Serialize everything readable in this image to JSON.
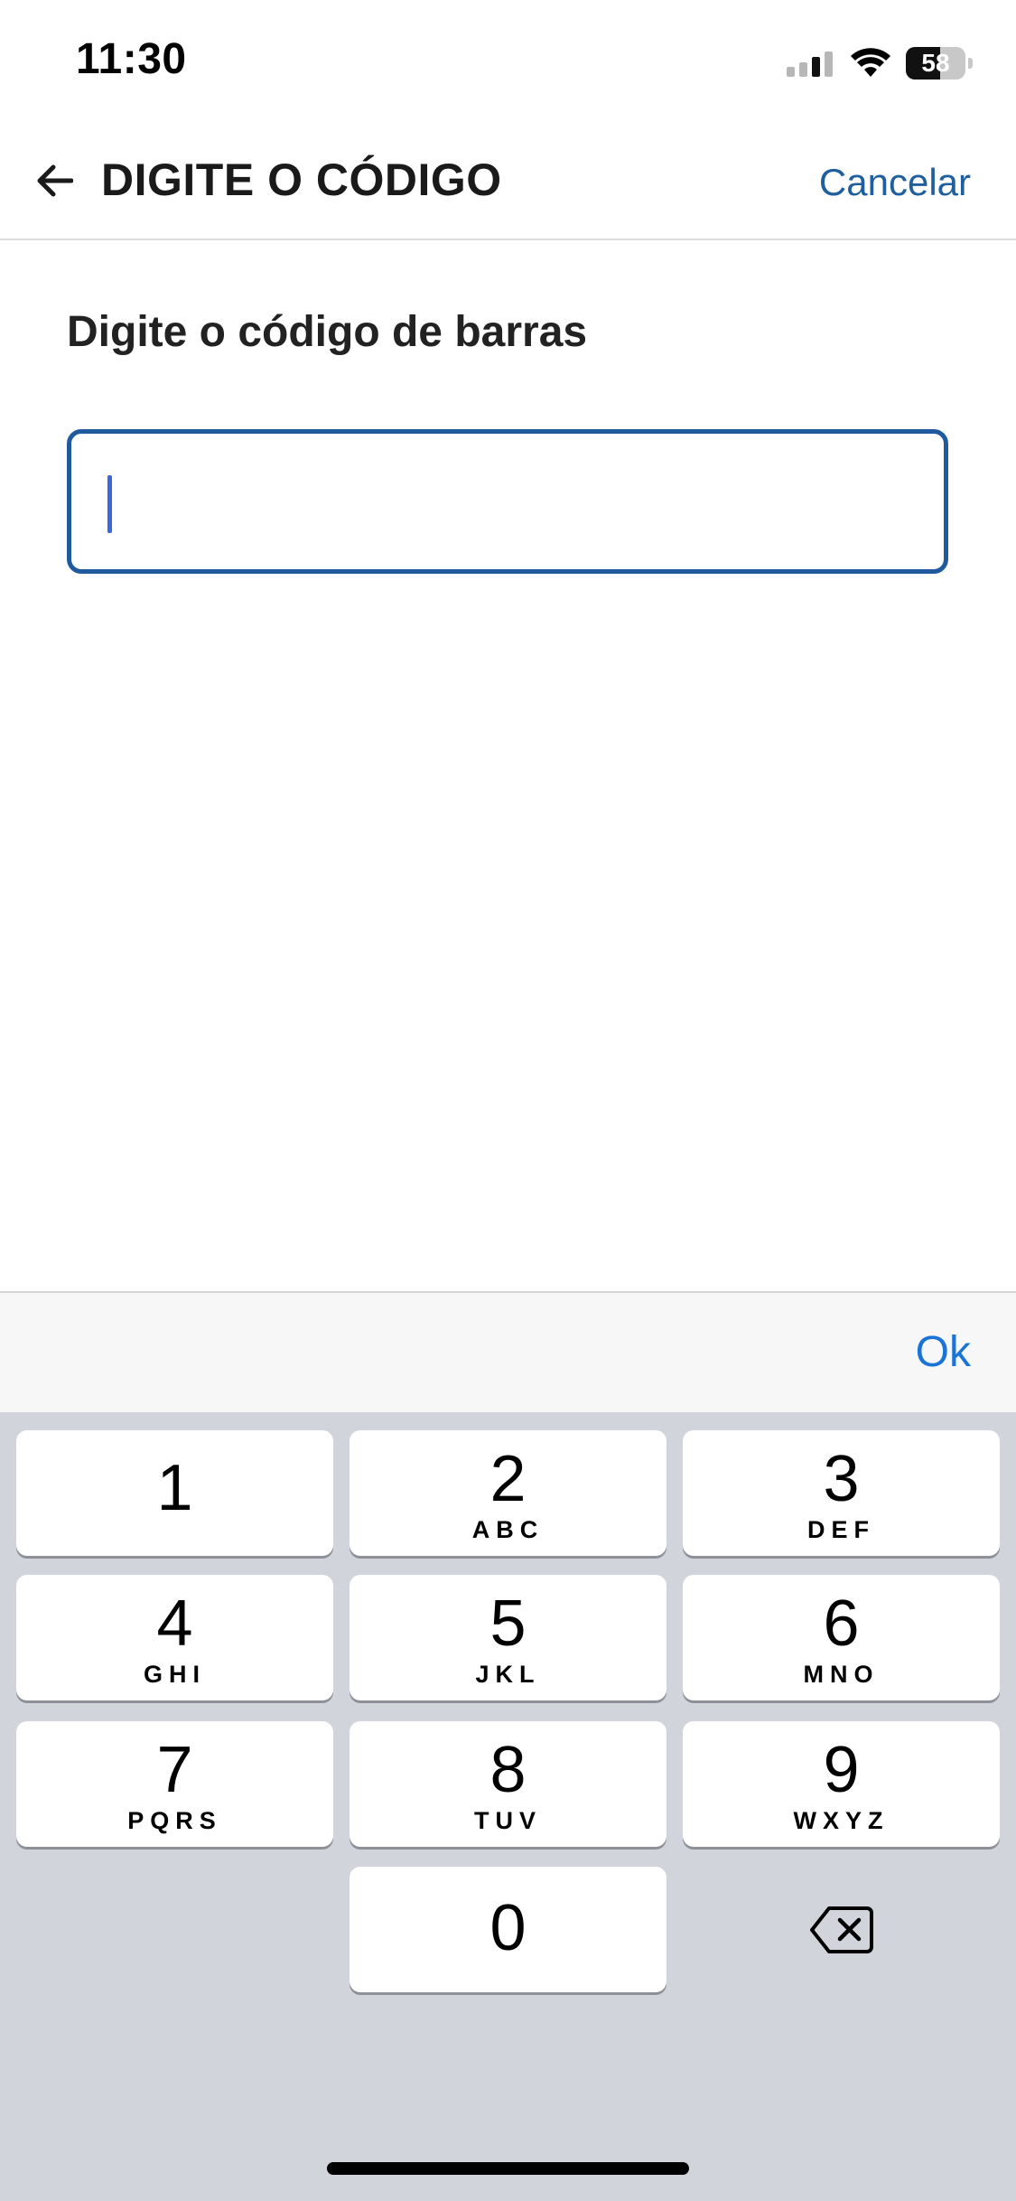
{
  "status_bar": {
    "time": "11:30",
    "battery_level": "58",
    "battery_fraction": 0.58,
    "icons": [
      "signal-icon",
      "wifi-icon",
      "battery-icon"
    ]
  },
  "header": {
    "back_icon": "arrow-left-icon",
    "title": "DIGITE O CÓDIGO",
    "cancel_label": "Cancelar"
  },
  "form": {
    "label": "Digite o código de barras",
    "input_value": "",
    "input_placeholder": ""
  },
  "keyboard": {
    "accessory_ok_label": "Ok",
    "keys": [
      {
        "digit": "1",
        "letters": ""
      },
      {
        "digit": "2",
        "letters": "ABC"
      },
      {
        "digit": "3",
        "letters": "DEF"
      },
      {
        "digit": "4",
        "letters": "GHI"
      },
      {
        "digit": "5",
        "letters": "JKL"
      },
      {
        "digit": "6",
        "letters": "MNO"
      },
      {
        "digit": "7",
        "letters": "PQRS"
      },
      {
        "digit": "8",
        "letters": "TUV"
      },
      {
        "digit": "9",
        "letters": "WXYZ"
      },
      {
        "digit": "0",
        "letters": ""
      }
    ],
    "delete_icon": "backspace-icon"
  },
  "colors": {
    "accent": "#1f5a9e",
    "link": "#1f5f9e",
    "ok": "#1a74d8",
    "keypad_bg": "#d1d4db"
  }
}
